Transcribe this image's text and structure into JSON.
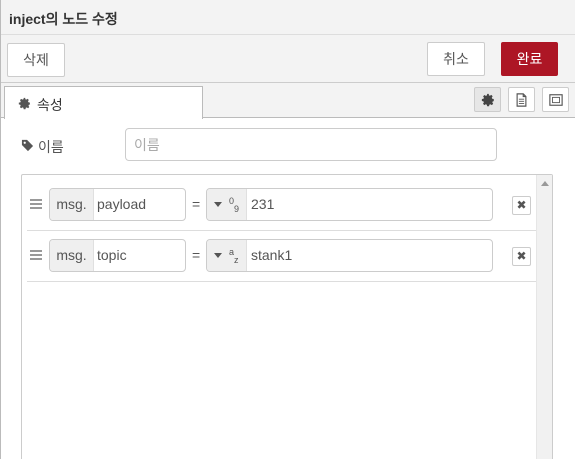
{
  "header": {
    "title_strong": "inject",
    "title_rest": "의 노드 수정"
  },
  "toolbar": {
    "delete_label": "삭제",
    "cancel_label": "취소",
    "done_label": "완료"
  },
  "tabs": [
    {
      "label": "속성",
      "icon": "gear-icon",
      "active": true
    }
  ],
  "tab_buttons": [
    {
      "name": "settings",
      "icon": "gear-icon",
      "active": true
    },
    {
      "name": "description",
      "icon": "file-icon",
      "active": false
    },
    {
      "name": "appearance",
      "icon": "window-icon",
      "active": false
    }
  ],
  "form": {
    "name_label": "이름",
    "name_placeholder": "이름",
    "name_value": ""
  },
  "props": [
    {
      "prefix": "msg.",
      "property": "payload",
      "equals": "=",
      "type_sup": "0",
      "type_sub": "9",
      "value": "231"
    },
    {
      "prefix": "msg.",
      "property": "topic",
      "equals": "=",
      "type_sup": "a",
      "type_sub": "z",
      "value": "stank1"
    }
  ],
  "colors": {
    "primary": "#ad1625",
    "border": "#cccccc",
    "toolbar_bg": "#f3f3f3"
  }
}
